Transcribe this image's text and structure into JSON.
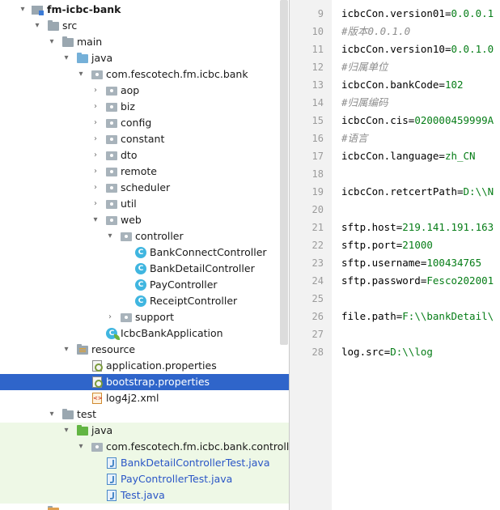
{
  "tree": {
    "root": "fm-icbc-bank",
    "src": "src",
    "main": "main",
    "java": "java",
    "package": "com.fescotech.fm.icbc.bank",
    "folders": [
      "aop",
      "biz",
      "config",
      "constant",
      "dto",
      "remote",
      "scheduler",
      "util"
    ],
    "web": "web",
    "controller": "controller",
    "controllers": [
      "BankConnectController",
      "BankDetailController",
      "PayController",
      "ReceiptController"
    ],
    "support": "support",
    "app": "IcbcBankApplication",
    "resource": "resource",
    "resource_files": [
      "application.properties",
      "bootstrap.properties",
      "log4j2.xml"
    ],
    "test": "test",
    "test_java": "java",
    "test_package": "com.fescotech.fm.icbc.bank.controlle",
    "test_files": [
      "BankDetailControllerTest.java",
      "PayControllerTest.java",
      "Test.java"
    ]
  },
  "editor": {
    "lines": [
      {
        "num": "9",
        "key": "icbcCon.version01",
        "val": "0.0.0.1",
        "comment": ""
      },
      {
        "num": "10",
        "key": "",
        "val": "",
        "comment": "#版本0.0.1.0"
      },
      {
        "num": "11",
        "key": "icbcCon.version10",
        "val": "0.0.1.0",
        "comment": ""
      },
      {
        "num": "12",
        "key": "",
        "val": "",
        "comment": "#归属单位"
      },
      {
        "num": "13",
        "key": "icbcCon.bankCode",
        "val": "102",
        "comment": ""
      },
      {
        "num": "14",
        "key": "",
        "val": "",
        "comment": "#归属编码"
      },
      {
        "num": "15",
        "key": "icbcCon.cis",
        "val": "020000459999A",
        "comment": ""
      },
      {
        "num": "16",
        "key": "",
        "val": "",
        "comment": "#语言"
      },
      {
        "num": "17",
        "key": "icbcCon.language",
        "val": "zh_CN",
        "comment": ""
      },
      {
        "num": "18",
        "key": "",
        "val": "",
        "comment": ""
      },
      {
        "num": "19",
        "key": "icbcCon.retcertPath",
        "val": "D:\\\\N",
        "comment": ""
      },
      {
        "num": "20",
        "key": "",
        "val": "",
        "comment": ""
      },
      {
        "num": "21",
        "key": "sftp.host",
        "val": "219.141.191.163",
        "comment": ""
      },
      {
        "num": "22",
        "key": "sftp.port",
        "val": "21000",
        "comment": ""
      },
      {
        "num": "23",
        "key": "sftp.username",
        "val": "100434765",
        "comment": ""
      },
      {
        "num": "24",
        "key": "sftp.password",
        "val": "Fesco202001",
        "comment": ""
      },
      {
        "num": "25",
        "key": "",
        "val": "",
        "comment": ""
      },
      {
        "num": "26",
        "key": "file.path",
        "val": "F:\\\\bankDetail\\",
        "comment": ""
      },
      {
        "num": "27",
        "key": "",
        "val": "",
        "comment": ""
      },
      {
        "num": "28",
        "key": "log.src",
        "val": "D:\\\\log",
        "comment": ""
      }
    ]
  },
  "colors": {
    "selection": "#2f65ca",
    "test_bg": "#eef8e6",
    "value_green": "#067d17",
    "comment_gray": "#8c8c8c",
    "gutter": "#f2f2f2"
  }
}
